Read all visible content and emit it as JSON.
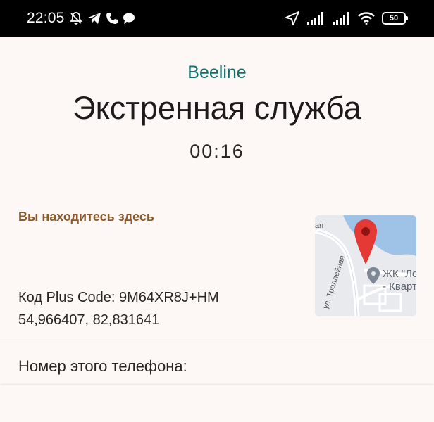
{
  "status_bar": {
    "time": "22:05",
    "battery": "50",
    "left_icons": [
      "bell-off-icon",
      "telegram-icon",
      "phone-icon",
      "chat-icon"
    ],
    "right_icons": [
      "location-arrow-icon",
      "signal-icon",
      "signal-icon",
      "wifi-icon",
      "battery-icon"
    ]
  },
  "call": {
    "carrier": "Beeline",
    "service": "Экстренная служба",
    "timer": "00:16"
  },
  "location": {
    "heading": "Вы находитесь здесь",
    "plus_code": "Код Plus Code: 9M64XR8J+HM",
    "coordinates": "54,966407, 82,831641",
    "map": {
      "street_label": "ул. Троллейная",
      "top_label": "ая",
      "poi_line1": "ЖК \"Ле",
      "poi_line2": "- Кварт",
      "pin_color": "#e53935",
      "water_color": "#9fc3e6"
    }
  },
  "phone_section": {
    "label": "Номер этого телефона:"
  },
  "colors": {
    "accent": "#15706a",
    "heading": "#8b5a2b",
    "background": "#fdf8f6"
  }
}
